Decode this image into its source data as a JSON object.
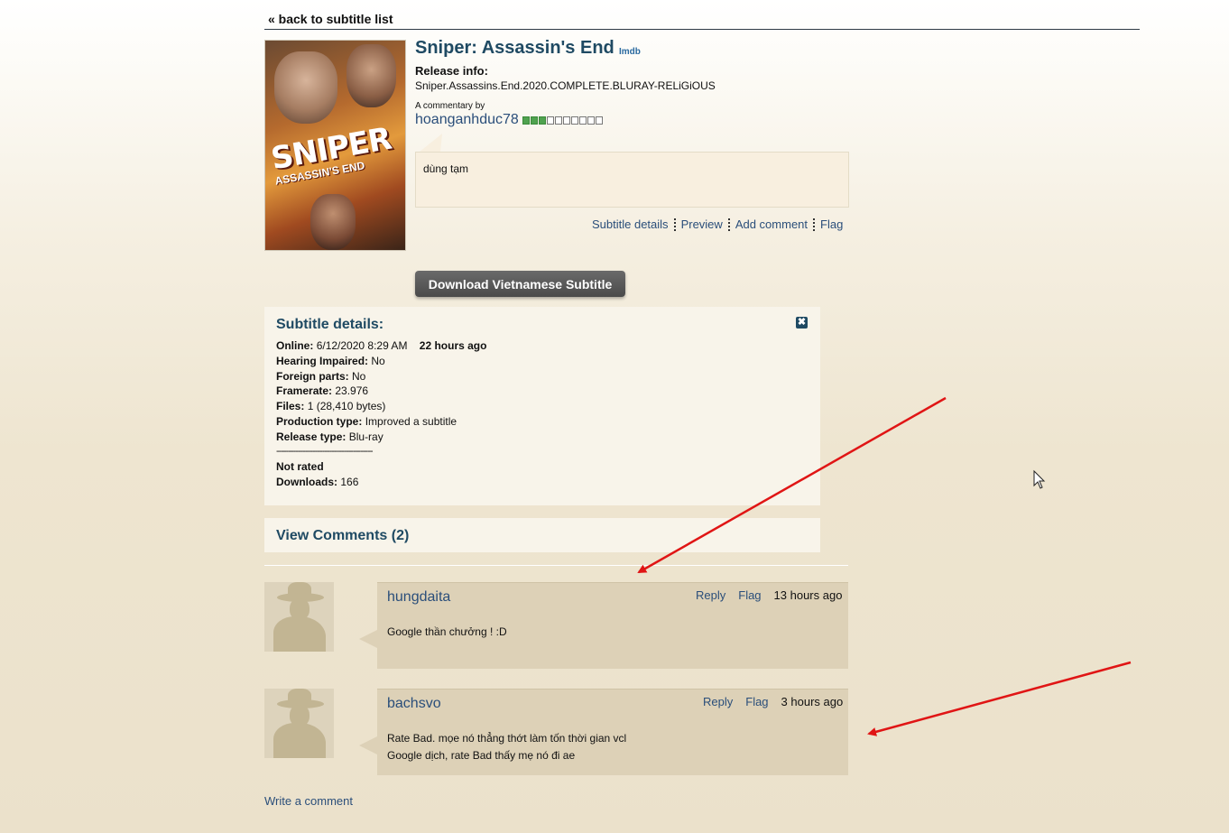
{
  "nav": {
    "back_label": "« back to subtitle list"
  },
  "movie": {
    "title": "Sniper: Assassin's End",
    "imdb_label": "Imdb",
    "poster_title": "SNIPER",
    "poster_subtitle": "ASSASSIN'S END",
    "release_label": "Release info:",
    "release_value": "Sniper.Assassins.End.2020.COMPLETE.BLURAY-RELiGiOUS",
    "commentary_label": "A commentary by",
    "author": "hoanganhduc78",
    "rank_filled": 3,
    "rank_total": 10,
    "commentary": "dùng tạm"
  },
  "actions": [
    "Subtitle details",
    "Preview",
    "Add comment",
    "Flag"
  ],
  "download_label": "Download Vietnamese Subtitle",
  "details": {
    "title": "Subtitle details:",
    "close_symbol": "✖",
    "online_label": "Online:",
    "online_value": "6/12/2020 8:29 AM",
    "online_ago": "22 hours ago",
    "hearing_label": "Hearing Impaired:",
    "hearing_value": "No",
    "foreign_label": "Foreign parts:",
    "foreign_value": "No",
    "framerate_label": "Framerate:",
    "framerate_value": "23.976",
    "files_label": "Files:",
    "files_value": "1 (28,410 bytes)",
    "production_label": "Production type:",
    "production_value": "Improved a subtitle",
    "release_type_label": "Release type:",
    "release_type_value": "Blu-ray",
    "separator": "----------------------------------------",
    "rating": "Not rated",
    "downloads_label": "Downloads:",
    "downloads_value": "166"
  },
  "comments": {
    "header": "View Comments (2)",
    "items": [
      {
        "user": "hungdaita",
        "reply": "Reply",
        "flag": "Flag",
        "time": "13 hours ago",
        "lines": [
          "Google thần chưởng ! :D"
        ]
      },
      {
        "user": "bachsvo",
        "reply": "Reply",
        "flag": "Flag",
        "time": "3 hours ago",
        "lines": [
          "Rate Bad. mọe nó thẳng thớt làm tốn thời gian vcl",
          "Google dịch, rate Bad thấy mẹ nó đi ae"
        ]
      }
    ],
    "write_label": "Write a comment"
  },
  "colors": {
    "annotation_arrow": "#e01515",
    "heading": "#1f4a63",
    "link": "#2a4e7a"
  }
}
